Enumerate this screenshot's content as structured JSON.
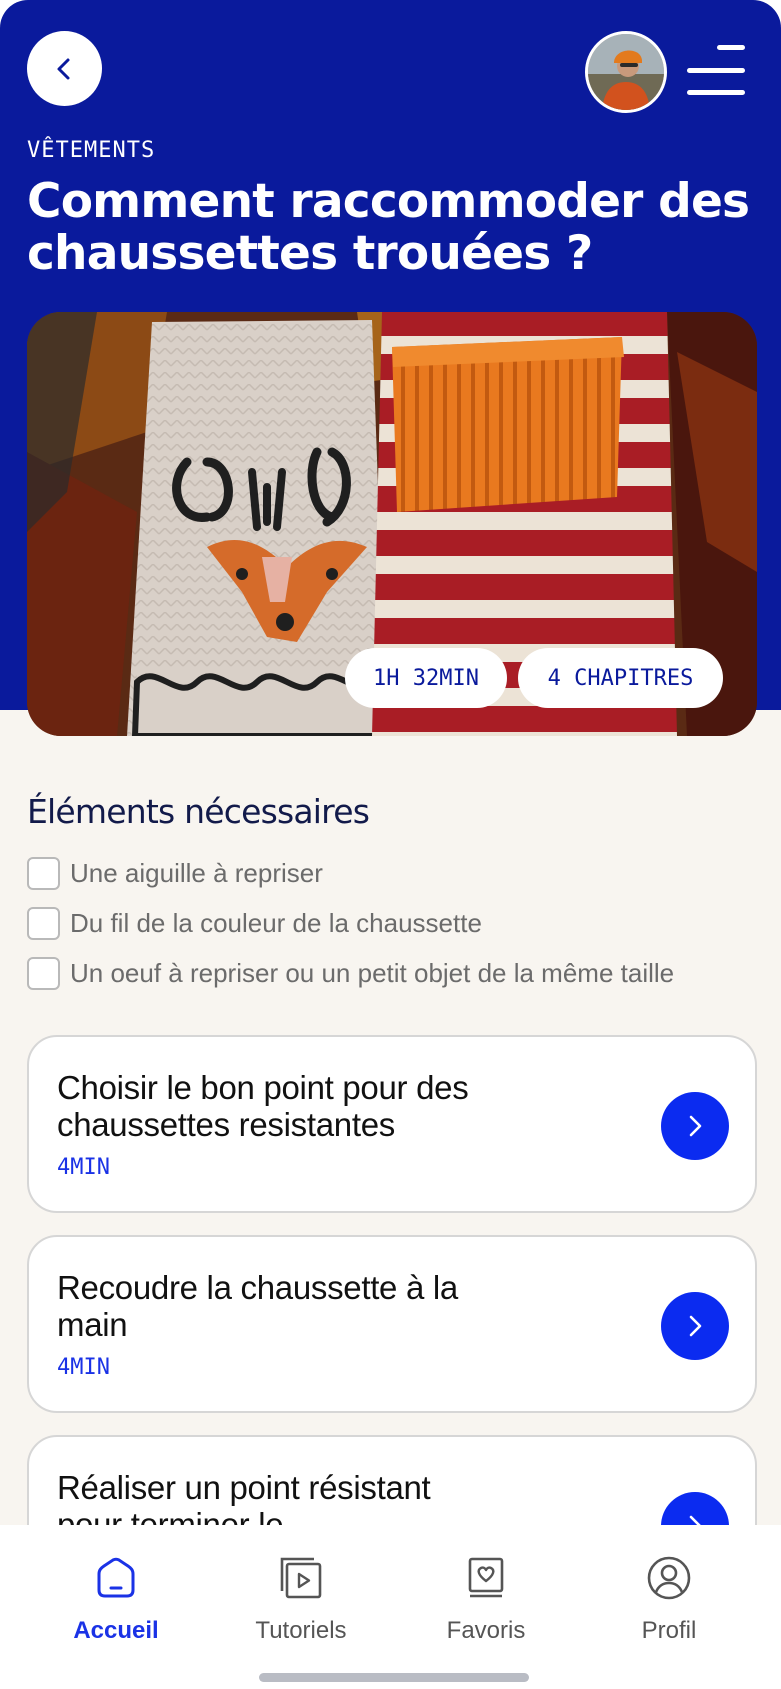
{
  "header": {
    "category": "VÊTEMENTS",
    "title": "Comment raccommoder des chaussettes trouées ?",
    "duration": "1H 32MIN",
    "chapters_count": "4 CHAPITRES"
  },
  "materials": {
    "title": "Éléments nécessaires",
    "items": [
      "Une aiguille à repriser",
      "Du fil de la couleur de la chaussette",
      "Un oeuf à repriser ou un petit objet de la même taille"
    ]
  },
  "chapters": [
    {
      "title": "Choisir le bon point pour des chaussettes resistantes",
      "time": "4MIN"
    },
    {
      "title": "Recoudre la chaussette à la main",
      "time": "4MIN"
    },
    {
      "title": "Réaliser un point résistant pour terminer le",
      "time": ""
    }
  ],
  "bottom_nav": {
    "items": [
      {
        "label": "Accueil",
        "icon": "home-icon",
        "active": true
      },
      {
        "label": "Tutoriels",
        "icon": "video-library-icon",
        "active": false
      },
      {
        "label": "Favoris",
        "icon": "favorite-book-icon",
        "active": false
      },
      {
        "label": "Profil",
        "icon": "user-icon",
        "active": false
      }
    ]
  },
  "colors": {
    "primary_blue": "#0a1a9c",
    "accent_blue": "#0b2bf0",
    "background": "#f8f5f0"
  }
}
